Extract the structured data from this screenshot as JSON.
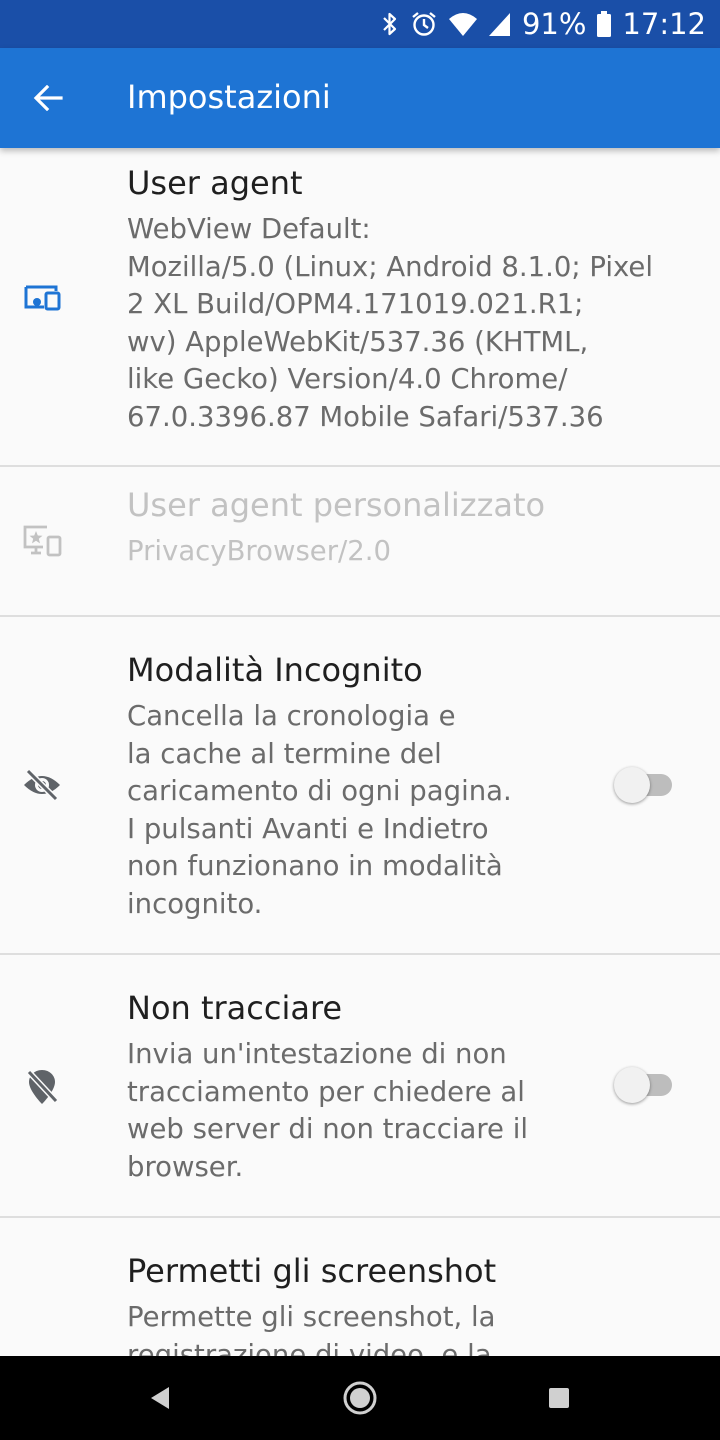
{
  "status_bar": {
    "battery": "91%",
    "time": "17:12",
    "icons": [
      "bluetooth-icon",
      "alarm-icon",
      "wifi-icon",
      "cell-signal-icon",
      "battery-icon"
    ]
  },
  "toolbar": {
    "back_icon": "arrow-back-icon",
    "title": "Impostazioni",
    "color": "#1e74d4"
  },
  "preferences": [
    {
      "icon": "devices-icon",
      "title": "User agent",
      "summary": "WebView Default:\nMozilla/5.0 (Linux; Android 8.1.0; Pixel\n2 XL Build/OPM4.171019.021.R1;\nwv) AppleWebKit/537.36 (KHTML,\nlike Gecko) Version/4.0 Chrome/\n67.0.3396.87 Mobile Safari/537.36",
      "enabled": true
    },
    {
      "icon": "custom-user-agent-icon",
      "title": "User agent personalizzato",
      "summary": "PrivacyBrowser/2.0",
      "enabled": false
    },
    {
      "icon": "eye-off-icon",
      "title": "Modalità Incognito",
      "summary": "Cancella la cronologia e\nla cache al termine del\ncaricamento di ogni pagina.\nI pulsanti Avanti e Indietro\nnon funzionano in modalità\nincognito.",
      "switch_on": false
    },
    {
      "icon": "location-off-icon",
      "title": "Non tracciare",
      "summary": "Invia un'intestazione di non\ntracciamento per chiedere al\nweb server di non tracciare il\nbrowser.",
      "switch_on": false
    },
    {
      "icon": "",
      "title": "Permetti gli screenshot",
      "summary": "Permette gli screenshot, la\nregistrazione di video, e la"
    }
  ],
  "nav_bar": {
    "icons": [
      "nav-back-icon",
      "nav-home-icon",
      "nav-recents-icon"
    ]
  }
}
